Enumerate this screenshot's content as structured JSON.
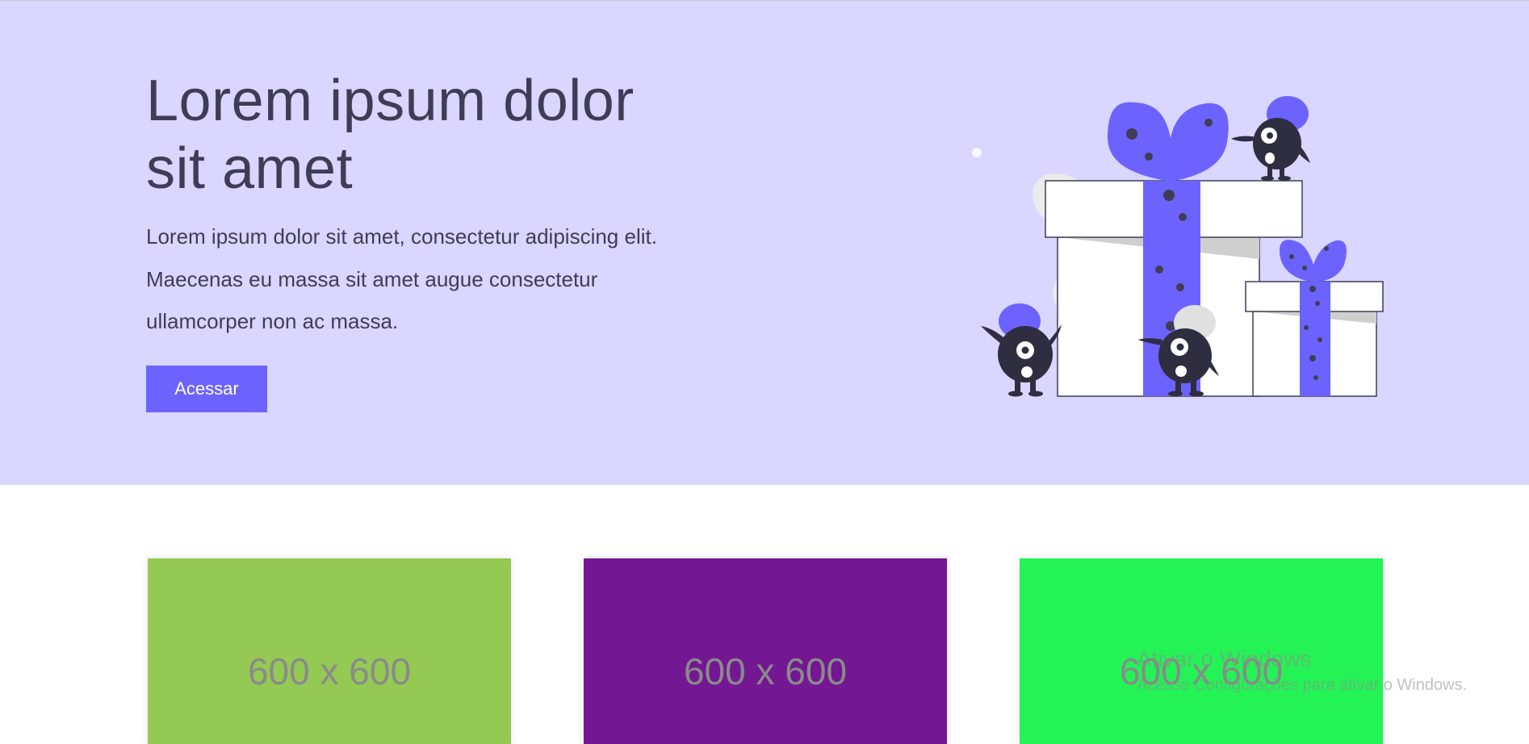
{
  "hero": {
    "title_line1": "Lorem ipsum dolor",
    "title_line2": "sit amet",
    "description": "Lorem ipsum dolor sit amet, consectetur adipiscing elit. Maecenas eu massa sit amet augue consectetur ullamcorper non ac massa.",
    "button_label": "Acessar",
    "illustration_name": "gift-boxes-monsters-illustration"
  },
  "cards": [
    {
      "label": "600 x 600",
      "color": "#94c953"
    },
    {
      "label": "600 x 600",
      "color": "#741793"
    },
    {
      "label": "600 x 600",
      "color": "#24f356"
    }
  ],
  "colors": {
    "hero_bg": "#d9d6ff",
    "accent": "#6c63ff",
    "text_dark": "#3f3d56"
  },
  "watermark": {
    "title": "Ativar o Windows",
    "subtitle": "Acesse Configurações para ativar o Windows."
  }
}
